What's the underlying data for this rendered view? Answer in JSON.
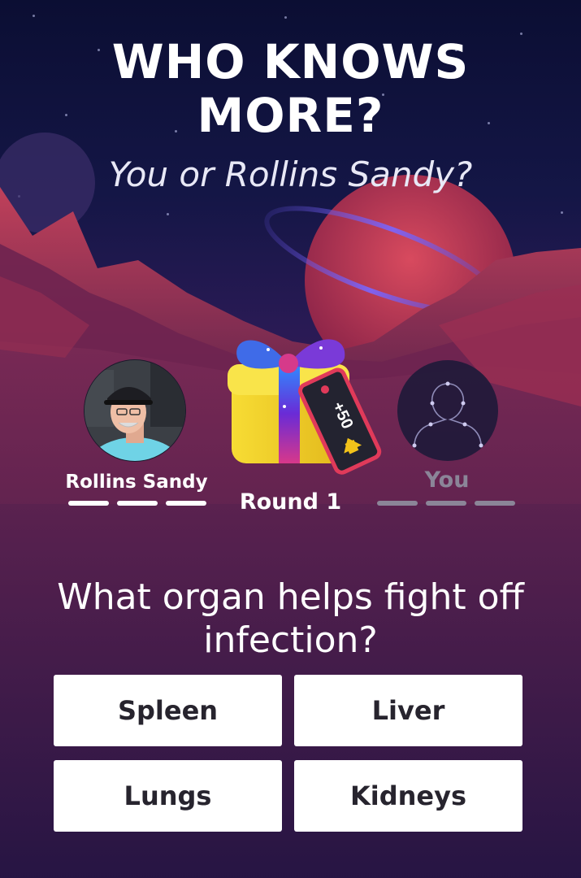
{
  "header": {
    "title_line1": "WHO KNOWS",
    "title_line2": "MORE?",
    "subtitle": "You or Rollins Sandy?"
  },
  "players": {
    "opponent": {
      "name": "Rollins Sandy",
      "score_marks": 3
    },
    "self": {
      "name": "You",
      "score_marks": 3
    }
  },
  "round": {
    "label": "Round 1",
    "bonus_tag": "+50"
  },
  "question": {
    "text": "What organ helps fight off infection?"
  },
  "answers": [
    {
      "label": "Spleen"
    },
    {
      "label": "Liver"
    },
    {
      "label": "Lungs"
    },
    {
      "label": "Kidneys"
    }
  ],
  "colors": {
    "sky_top": "#0b0e33",
    "planet": "#b8344f",
    "canyon": "#8a2a4e",
    "gift_box": "#f2d32b",
    "gift_ribbon": "#5b2bd6",
    "tag": "#e03a5a",
    "answer_bg": "#ffffff",
    "dash_active": "#ffffff",
    "dash_inactive": "#8b8598"
  },
  "icons": {
    "opponent_avatar": "person-photo",
    "self_avatar": "constellation-silhouette-icon",
    "gift": "gift-box-icon",
    "tag_rocket": "rocket-icon"
  }
}
